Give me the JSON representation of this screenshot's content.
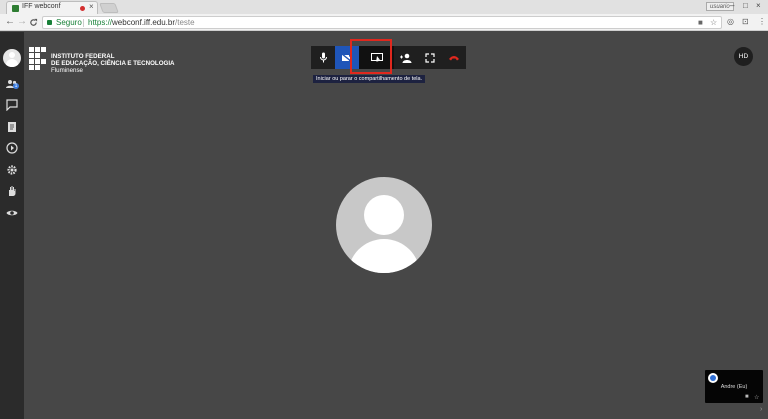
{
  "browser": {
    "tab_title": "IFF webconf",
    "tab_close": "×",
    "user_badge": "usuario",
    "back": "←",
    "forward": "→",
    "reload": "C",
    "secure_label": "Seguro",
    "url_protocol": "https://",
    "url_host": "webconf.iff.edu.br",
    "url_path": "/teste",
    "menu": "⋮",
    "star": "☆"
  },
  "logo": {
    "line1": "INSTITUTO FEDERAL",
    "line2": "DE EDUCAÇÃO, CIÊNCIA E TECNOLOGIA",
    "line3": "Fluminense"
  },
  "sidebar": {
    "participants_badge": "1",
    "icons": [
      "participants-icon",
      "chat-icon",
      "document-icon",
      "play-icon",
      "settings-icon",
      "raise-hand-icon",
      "eye-icon"
    ]
  },
  "toolbar": {
    "tooltip": "Iniciar ou parar o compartilhamento de tela.",
    "hangup_color": "#e0281e",
    "active_color": "#1f55b8"
  },
  "hd_label": "HD",
  "thumbnail": {
    "name": "Andre (Eu)"
  },
  "colors": {
    "background": "#474747",
    "sidebar": "#2b2b2b",
    "highlight": "#e0281e"
  }
}
